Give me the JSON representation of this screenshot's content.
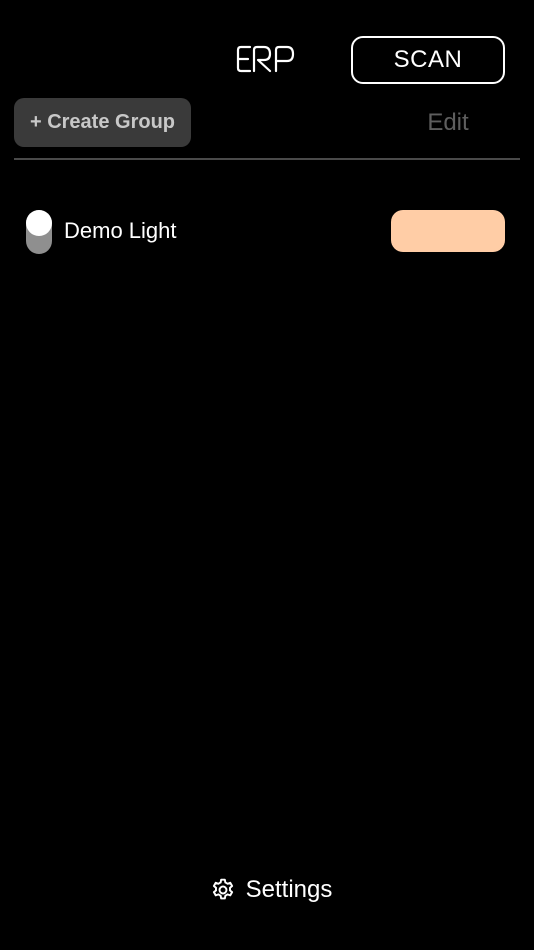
{
  "header": {
    "logo_icon": "erp-logo",
    "scan_label": "SCAN"
  },
  "toolbar": {
    "create_group_label": "+ Create Group",
    "edit_label": "Edit"
  },
  "lights": [
    {
      "name": "Demo Light",
      "power_icon": "power-toggle-switch",
      "color": "#ffcda6"
    }
  ],
  "footer": {
    "settings_icon": "gear-icon",
    "settings_label": "Settings"
  },
  "colors": {
    "background": "#000000",
    "divider": "#4a4a4a",
    "create_group_bg": "#3a3a3a",
    "edit_disabled": "#5e5e5e"
  }
}
